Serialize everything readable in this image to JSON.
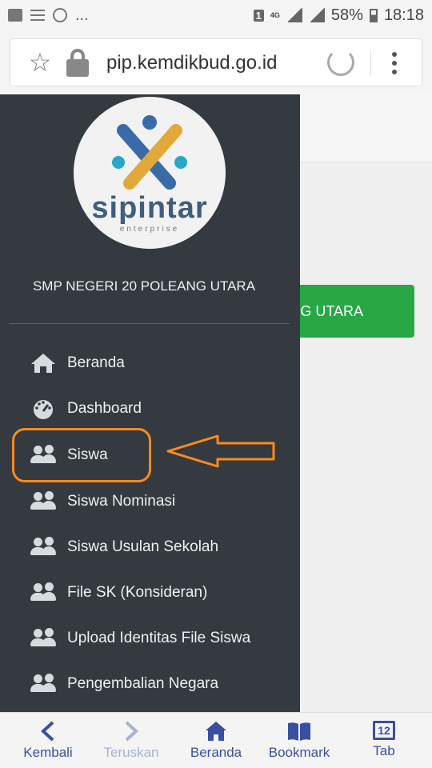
{
  "statusbar": {
    "notification_count": "1",
    "network": "4G",
    "battery": "58%",
    "time": "18:18"
  },
  "browser": {
    "url": "pip.kemdikbud.go.id"
  },
  "drawer": {
    "logo_text": "sipintar",
    "logo_subtext": "enterprise",
    "school_name": "SMP NEGERI 20 POLEANG UTARA",
    "menu": [
      {
        "label": "Beranda",
        "icon": "home-icon"
      },
      {
        "label": "Dashboard",
        "icon": "gauge-icon"
      },
      {
        "label": "Siswa",
        "icon": "users-icon"
      },
      {
        "label": "Siswa Nominasi",
        "icon": "users-icon"
      },
      {
        "label": "Siswa Usulan Sekolah",
        "icon": "users-icon"
      },
      {
        "label": "File SK (Konsideran)",
        "icon": "users-icon"
      },
      {
        "label": "Upload Identitas File Siswa",
        "icon": "users-icon"
      },
      {
        "label": "Pengembalian Negara",
        "icon": "users-icon"
      }
    ]
  },
  "page": {
    "green_button_text": "NG UTARA"
  },
  "annotation": {
    "color": "#ff8a1f"
  },
  "bottom_nav": [
    {
      "label": "Kembali",
      "enabled": true
    },
    {
      "label": "Teruskan",
      "enabled": false
    },
    {
      "label": "Beranda",
      "enabled": true
    },
    {
      "label": "Bookmark",
      "enabled": true
    },
    {
      "label": "Tab",
      "enabled": true,
      "tab_count": "12"
    }
  ],
  "colors": {
    "drawer_bg": "#343a40",
    "green_button": "#28a745",
    "nav_accent": "#3b4fa0"
  }
}
